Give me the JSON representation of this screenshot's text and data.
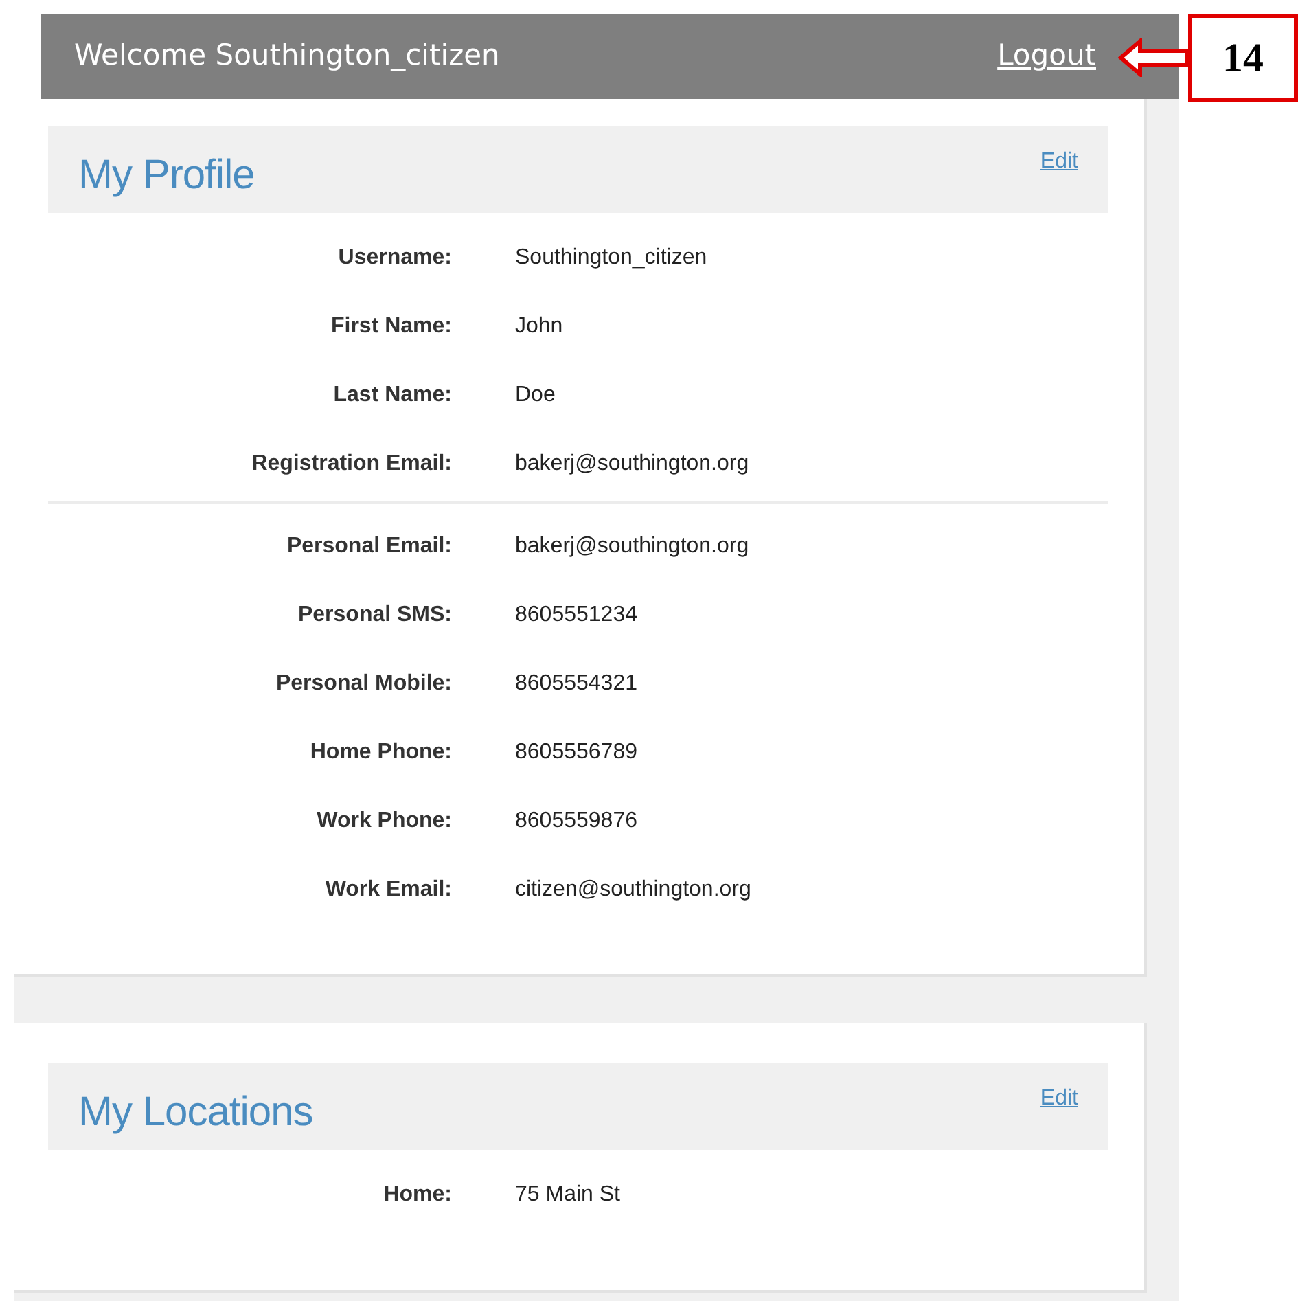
{
  "header": {
    "welcome": "Welcome Southington_citizen",
    "logout": "Logout"
  },
  "callout": {
    "label": "14"
  },
  "sections": [
    {
      "title": "My Profile",
      "edit": "Edit",
      "groups": [
        [
          {
            "label": "Username:",
            "value": "Southington_citizen"
          },
          {
            "label": "First Name:",
            "value": "John"
          },
          {
            "label": "Last Name:",
            "value": "Doe"
          },
          {
            "label": "Registration Email:",
            "value": "bakerj@southington.org"
          }
        ],
        [
          {
            "label": "Personal Email:",
            "value": "bakerj@southington.org"
          },
          {
            "label": "Personal SMS:",
            "value": "8605551234"
          },
          {
            "label": "Personal Mobile:",
            "value": "8605554321"
          },
          {
            "label": "Home Phone:",
            "value": "8605556789"
          },
          {
            "label": "Work Phone:",
            "value": "8605559876"
          },
          {
            "label": "Work Email:",
            "value": "citizen@southington.org"
          }
        ]
      ]
    },
    {
      "title": "My Locations",
      "edit": "Edit",
      "groups": [
        [
          {
            "label": "Home:",
            "value": "75 Main St"
          }
        ]
      ]
    }
  ]
}
